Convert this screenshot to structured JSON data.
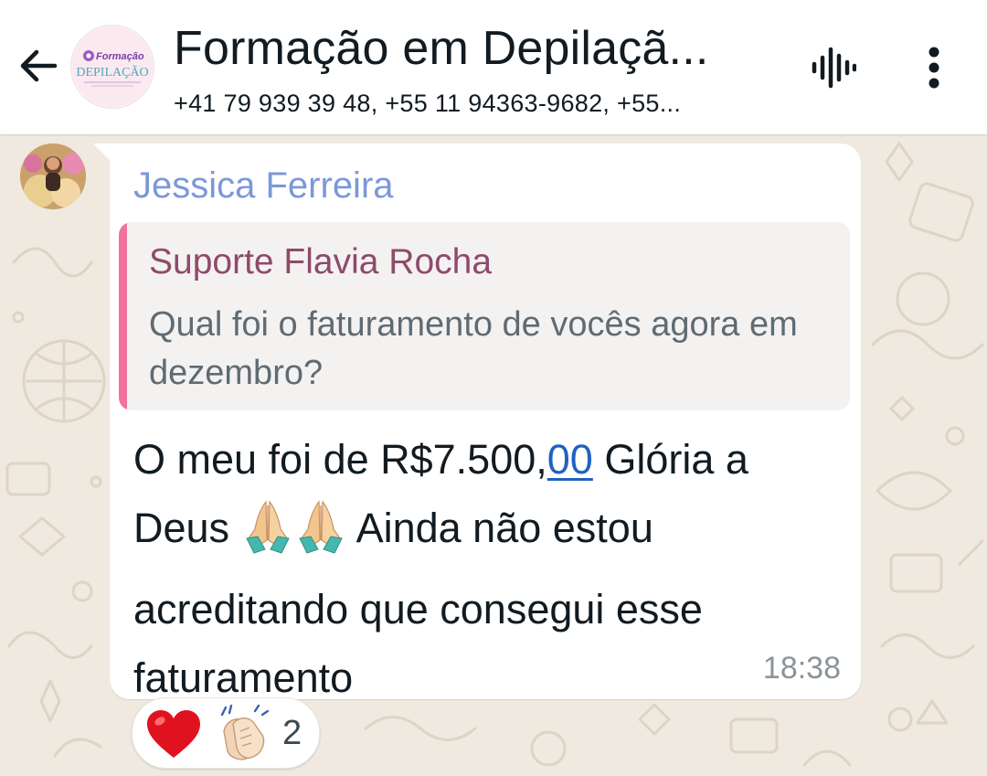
{
  "header": {
    "back_icon": "arrow-left-icon",
    "title": "Formação em Depilaçã...",
    "subtitle": "+41 79 939 39 48, +55 11 94363-9682, +55...",
    "avatar_logo_top": "Formação",
    "avatar_logo_main": "DEPILAÇÃO",
    "voice_icon": "audio-waveform-icon",
    "menu_icon": "more-vertical-icon"
  },
  "message": {
    "sender": "Jessica Ferreira",
    "quoted": {
      "author": "Suporte Flavia Rocha",
      "text": "Qual foi o faturamento de vocês agora em dezembro?"
    },
    "text_part1": "O meu foi de R$7.500,",
    "text_link": "00",
    "text_part2": " Glória a Deus ",
    "text_part3": " Ainda não estou acreditando que consegui esse faturamento",
    "emoji_name": "folded-hands-icon",
    "time": "18:38"
  },
  "reactions": {
    "items": [
      "heart-icon",
      "clapping-hands-icon"
    ],
    "count": "2"
  },
  "colors": {
    "sender_name": "#7b98d8",
    "quote_author": "#8f4a6b",
    "quote_bar": "#f0739b",
    "link": "#1f62c0",
    "wallpaper": "#efe9df"
  }
}
